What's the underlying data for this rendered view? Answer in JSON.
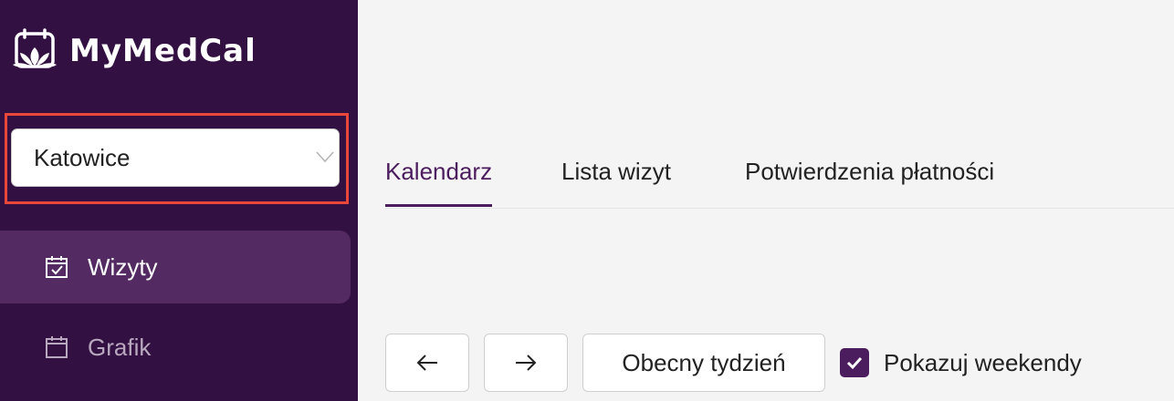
{
  "app": {
    "name": "MyMedCal"
  },
  "location_select": {
    "value": "Katowice"
  },
  "sidebar": {
    "items": [
      {
        "label": "Wizyty",
        "icon": "calendar-check-icon",
        "active": true
      },
      {
        "label": "Grafik",
        "icon": "calendar-icon",
        "active": false
      }
    ]
  },
  "tabs": [
    {
      "label": "Kalendarz",
      "active": true
    },
    {
      "label": "Lista wizyt",
      "active": false
    },
    {
      "label": "Potwierdzenia płatności",
      "active": false
    }
  ],
  "toolbar": {
    "prev_icon": "arrow-left-icon",
    "next_icon": "arrow-right-icon",
    "current_week_label": "Obecny tydzień",
    "weekends": {
      "label": "Pokazuj weekendy",
      "checked": true
    }
  },
  "colors": {
    "sidebar_bg": "#331042",
    "active_item_bg": "#542a62",
    "accent": "#4c1d5e",
    "highlight_border": "#e8473a",
    "content_bg": "#f4f4f4"
  }
}
